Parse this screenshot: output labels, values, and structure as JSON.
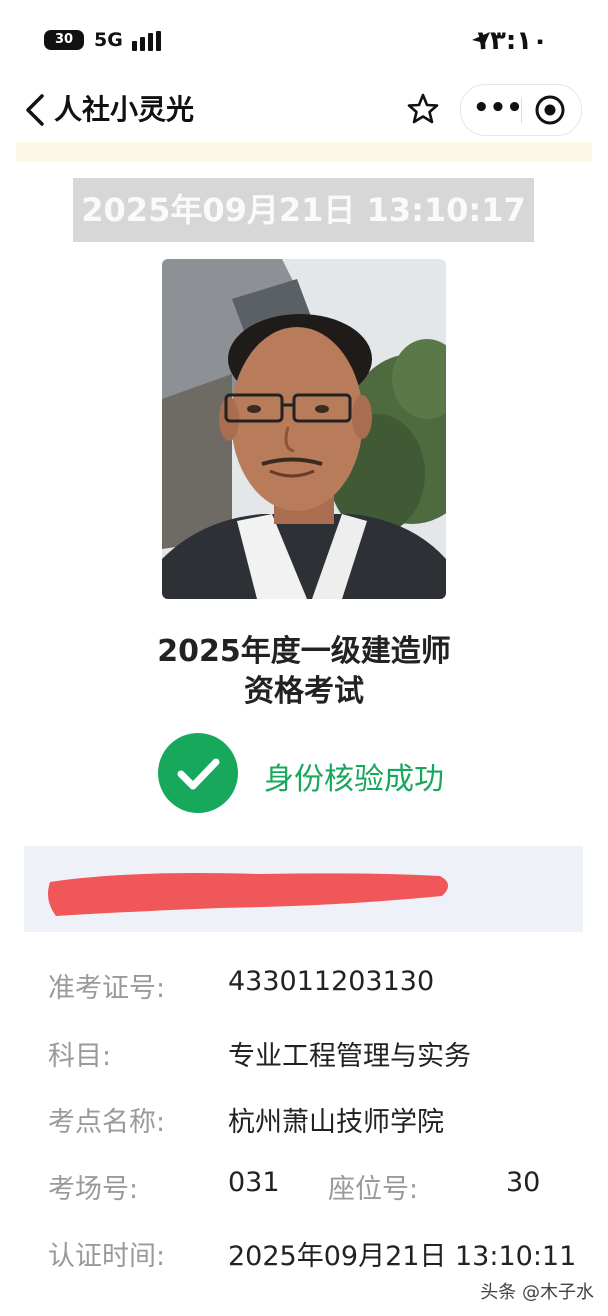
{
  "status_bar": {
    "battery": "30",
    "network": "5G",
    "time": "١٣:١٠",
    "icons": [
      "battery-icon",
      "signal-icon",
      "location-arrow-icon"
    ]
  },
  "nav": {
    "title": "人社小灵光",
    "back_icon": "chevron-left-icon",
    "star_icon": "star-outline-icon",
    "more_label": "•••",
    "close_icon": "target-circle-icon"
  },
  "timestamp": "2025年09月21日 13:10:17",
  "exam": {
    "title_line1": "2025年度一级建造师",
    "title_line2": "资格考试"
  },
  "verify": {
    "status": "身份核验成功",
    "color": "#18a85b"
  },
  "info": {
    "admission_label": "准考证号:",
    "admission_value": "433011203130",
    "subject_label": "科目:",
    "subject_value": "专业工程管理与实务",
    "site_label": "考点名称:",
    "site_value": "杭州萧山技师学院",
    "room_label": "考场号:",
    "room_value": "031",
    "seat_label": "座位号:",
    "seat_value": "30",
    "cert_time_label": "认证时间:",
    "cert_time_value": "2025年09月21日 13:10:11"
  },
  "watermark": "头条 @木子水"
}
